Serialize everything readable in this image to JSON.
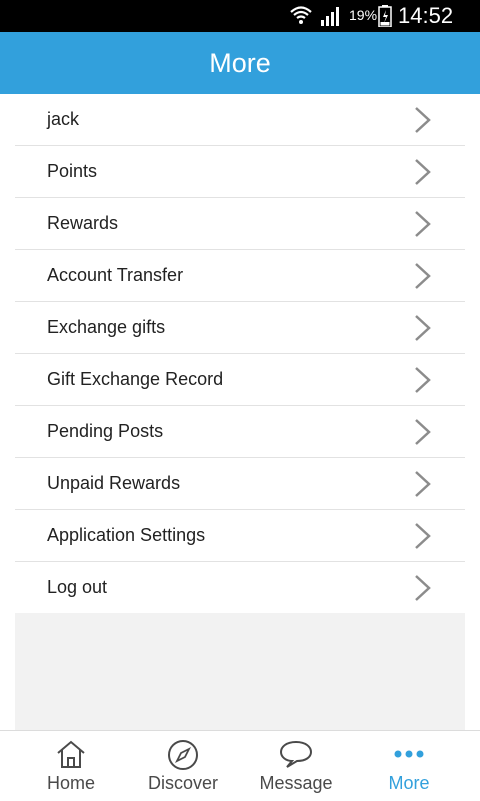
{
  "status_bar": {
    "battery_percent": "19%",
    "time": "14:52"
  },
  "header": {
    "title": "More"
  },
  "menu": {
    "items": [
      {
        "label": "jack"
      },
      {
        "label": "Points"
      },
      {
        "label": "Rewards"
      },
      {
        "label": "Account Transfer"
      },
      {
        "label": "Exchange gifts"
      },
      {
        "label": "Gift Exchange Record"
      },
      {
        "label": "Pending Posts"
      },
      {
        "label": "Unpaid Rewards"
      },
      {
        "label": "Application Settings"
      },
      {
        "label": "Log out"
      }
    ]
  },
  "bottom_nav": {
    "items": [
      {
        "label": "Home",
        "icon": "home-icon"
      },
      {
        "label": "Discover",
        "icon": "compass-icon"
      },
      {
        "label": "Message",
        "icon": "speech-bubble-icon"
      },
      {
        "label": "More",
        "icon": "more-dots-icon",
        "active": true
      }
    ]
  },
  "colors": {
    "accent": "#32a0dc",
    "status_bar": "#000000",
    "panel_background": "#f2f2f2",
    "chevron": "#8c8c8c"
  }
}
